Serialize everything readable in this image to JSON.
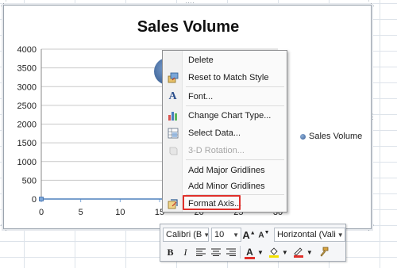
{
  "chart": {
    "title": "Sales Volume",
    "legend_label": "Sales Volume"
  },
  "chart_data": {
    "type": "scatter",
    "title": "Sales Volume",
    "series": [
      {
        "name": "Sales Volume",
        "points": []
      }
    ],
    "x_ticks": [
      "0",
      "5",
      "10",
      "15",
      "20",
      "25",
      "30"
    ],
    "y_ticks": [
      "0",
      "500",
      "1000",
      "1500",
      "2000",
      "2500",
      "3000",
      "3500",
      "4000"
    ],
    "xlim": [
      0,
      30
    ],
    "ylim": [
      0,
      4000
    ],
    "grid": "horizontal",
    "legend_position": "right"
  },
  "context_menu": {
    "items": [
      {
        "label": "Delete",
        "icon": "none-icon",
        "disabled": false
      },
      {
        "label": "Reset to Match Style",
        "icon": "reset-style-icon",
        "disabled": false
      },
      {
        "label": "Font...",
        "icon": "font-icon",
        "disabled": false
      },
      {
        "label": "Change Chart Type...",
        "icon": "chart-type-icon",
        "disabled": false
      },
      {
        "label": "Select Data...",
        "icon": "select-data-icon",
        "disabled": false
      },
      {
        "label": "3-D Rotation...",
        "icon": "rotation-icon",
        "disabled": true
      },
      {
        "label": "Add Major Gridlines",
        "icon": "none-icon",
        "disabled": false
      },
      {
        "label": "Add Minor Gridlines",
        "icon": "none-icon",
        "disabled": false
      },
      {
        "label": "Format Axis...",
        "icon": "format-axis-icon",
        "disabled": false
      }
    ]
  },
  "mini_toolbar": {
    "font_name": "Calibri (B",
    "font_size": "10",
    "alignment": "Horizontal (Vali",
    "accent_red": "#e0302b"
  }
}
